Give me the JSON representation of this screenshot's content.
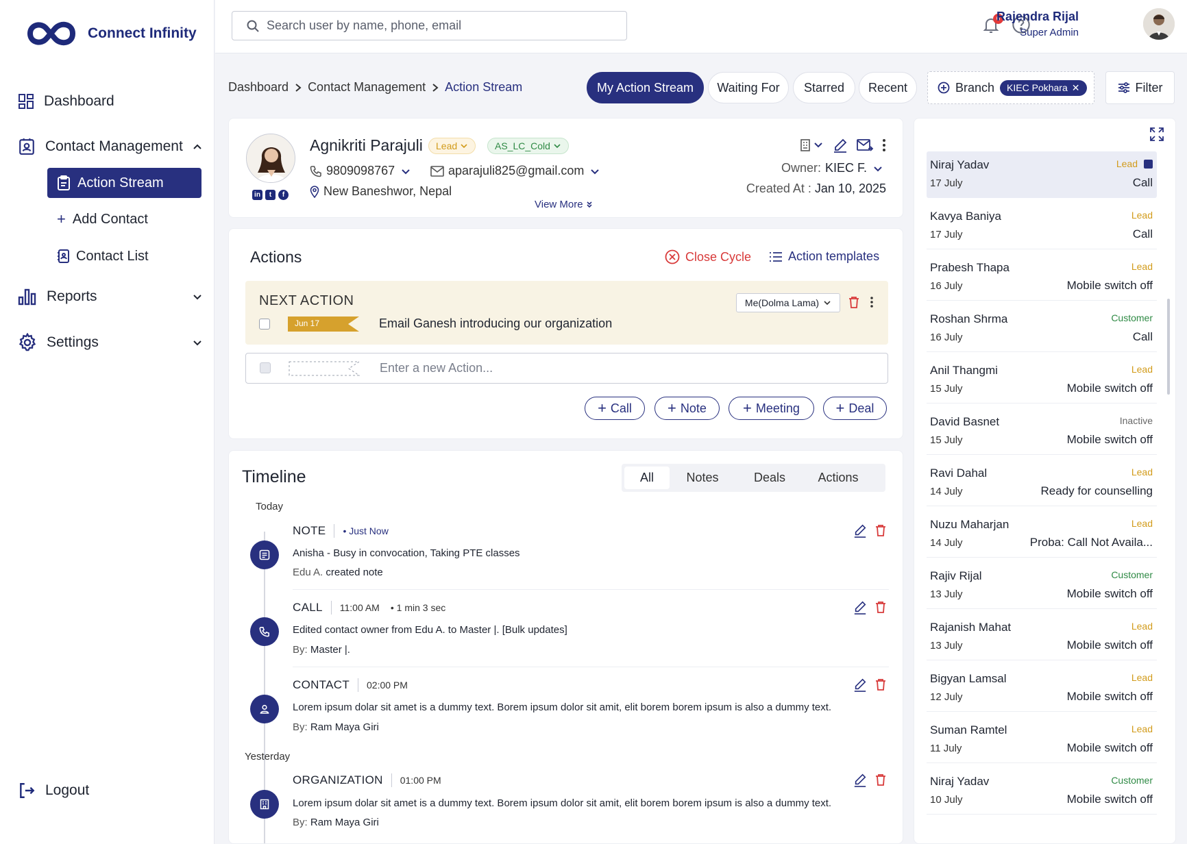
{
  "app": {
    "name": "Connect Infinity"
  },
  "colors": {
    "primary": "#28307f",
    "lead": "#d29b1a",
    "customer": "#2f8a45",
    "inactive": "#666666",
    "danger": "#d83a3a"
  },
  "sidebar": {
    "dashboard": "Dashboard",
    "contact_management": "Contact Management",
    "action_stream": "Action Stream",
    "add_contact": "Add Contact",
    "contact_list": "Contact List",
    "reports": "Reports",
    "settings": "Settings",
    "logout": "Logout"
  },
  "topbar": {
    "search_placeholder": "Search user by name, phone, email",
    "notification_count": "6",
    "user_name": "Rajendra Rijal",
    "user_role": "Super Admin"
  },
  "breadcrumb": [
    "Dashboard",
    "Contact Management",
    "Action Stream"
  ],
  "stream_tabs": [
    "My Action Stream",
    "Waiting For",
    "Starred",
    "Recent"
  ],
  "branch": {
    "label": "Branch",
    "chip": "KIEC Pokhara"
  },
  "filter_label": "Filter",
  "contact": {
    "name": "Agnikriti Parajuli",
    "tag_lead": "Lead",
    "tag_cold": "AS_LC_Cold",
    "phone": "9809098767",
    "email": "aparajuli825@gmail.com",
    "address": "New Baneshwor, Nepal",
    "view_more": "View More",
    "owner_label": "Owner:",
    "owner_value": "KIEC F.",
    "created_label": "Created At :",
    "created_value": "Jan 10, 2025"
  },
  "actions": {
    "title": "Actions",
    "close_cycle": "Close Cycle",
    "templates": "Action templates",
    "next_action_title": "NEXT ACTION",
    "next_action_date": "Jun 17",
    "next_action_text": "Email Ganesh introducing our organization",
    "assignee": "Me(Dolma Lama)",
    "new_placeholder": "Enter a new Action...",
    "buttons": [
      "Call",
      "Note",
      "Meeting",
      "Deal"
    ]
  },
  "timeline": {
    "title": "Timeline",
    "tabs": [
      "All",
      "Notes",
      "Deals",
      "Actions"
    ],
    "today": "Today",
    "yesterday": "Yesterday",
    "entries": [
      {
        "type": "NOTE",
        "time": "",
        "meta": "Just Now",
        "text": "Anisha - Busy in convocation, Taking PTE classes",
        "by_prefix": "Edu A.",
        "by_value": "created note"
      },
      {
        "type": "CALL",
        "time": "11:00 AM",
        "meta": "1 min 3 sec",
        "text": "Edited contact owner from Edu A. to Master |. [Bulk updates]",
        "by_prefix": "By:",
        "by_value": "Master |."
      },
      {
        "type": "CONTACT",
        "time": "02:00 PM",
        "meta": "",
        "text": "Lorem ipsum dolar sit amet is a dummy text. Borem ipsum dolor sit amit, elit borem borem ipsum is also a dummy text.",
        "by_prefix": "By:",
        "by_value": "Ram Maya Giri"
      },
      {
        "type": "ORGANIZATION",
        "time": "01:00 PM",
        "meta": "",
        "text": "Lorem ipsum dolar sit amet is a dummy text. Borem ipsum dolor sit amit, elit borem borem ipsum is also a dummy text.",
        "by_prefix": "By:",
        "by_value": "Ram Maya Giri"
      }
    ]
  },
  "stream_list": [
    {
      "name": "Niraj Yadav",
      "date": "17 July",
      "status": "Lead",
      "action": "Call"
    },
    {
      "name": "Kavya Baniya",
      "date": "17 July",
      "status": "Lead",
      "action": "Call"
    },
    {
      "name": "Prabesh Thapa",
      "date": "16 July",
      "status": "Lead",
      "action": "Mobile switch off"
    },
    {
      "name": "Roshan Shrma",
      "date": "16 July",
      "status": "Customer",
      "action": "Call"
    },
    {
      "name": "Anil Thangmi",
      "date": "15 July",
      "status": "Lead",
      "action": "Mobile switch off"
    },
    {
      "name": "David Basnet",
      "date": "15 July",
      "status": "Inactive",
      "action": "Mobile switch off"
    },
    {
      "name": "Ravi Dahal",
      "date": "14 July",
      "status": "Lead",
      "action": "Ready for counselling"
    },
    {
      "name": "Nuzu Maharjan",
      "date": "14 July",
      "status": "Lead",
      "action": "Proba: Call Not Availa..."
    },
    {
      "name": "Rajiv Rijal",
      "date": "13 July",
      "status": "Customer",
      "action": "Mobile switch off"
    },
    {
      "name": "Rajanish Mahat",
      "date": "13 July",
      "status": "Lead",
      "action": "Mobile switch off"
    },
    {
      "name": "Bigyan Lamsal",
      "date": "12 July",
      "status": "Lead",
      "action": "Mobile switch off"
    },
    {
      "name": "Suman Ramtel",
      "date": "11 July",
      "status": "Lead",
      "action": "Mobile switch off"
    },
    {
      "name": "Niraj Yadav",
      "date": "10 July",
      "status": "Customer",
      "action": "Mobile switch off"
    }
  ]
}
